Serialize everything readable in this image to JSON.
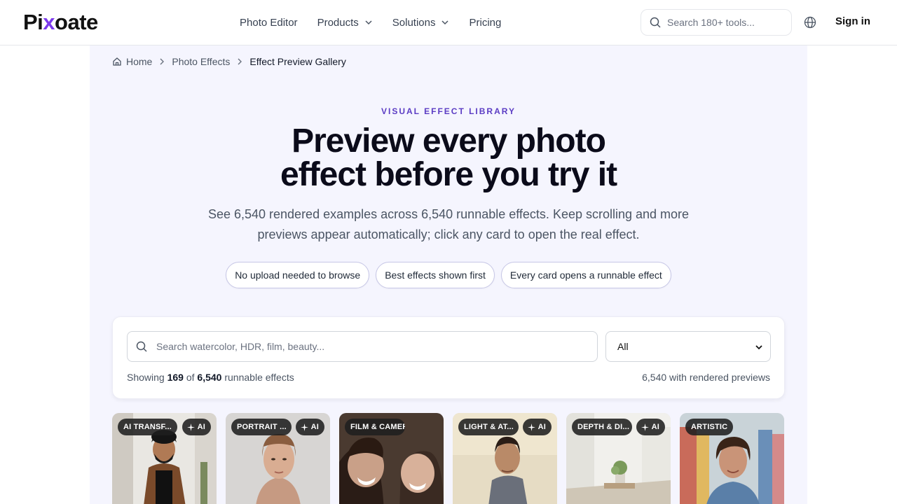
{
  "header": {
    "logo": {
      "pre": "Pi",
      "x": "x",
      "post": "oate"
    },
    "nav": [
      {
        "label": "Photo Editor",
        "dropdown": false
      },
      {
        "label": "Products",
        "dropdown": true
      },
      {
        "label": "Solutions",
        "dropdown": true
      },
      {
        "label": "Pricing",
        "dropdown": false
      }
    ],
    "search_placeholder": "Search 180+ tools...",
    "signin": "Sign in"
  },
  "breadcrumb": [
    "Home",
    "Photo Effects",
    "Effect Preview Gallery"
  ],
  "hero": {
    "eyebrow": "VISUAL EFFECT LIBRARY",
    "title_line1": "Preview every photo",
    "title_line2": "effect before you try it",
    "subtitle": "See 6,540 rendered examples across 6,540 runnable effects. Keep scrolling and more previews appear automatically; click any card to open the real effect.",
    "pills": [
      "No upload needed to browse",
      "Best effects shown first",
      "Every card opens a runnable effect"
    ]
  },
  "filter": {
    "search_placeholder": "Search watercolor, HDR, film, beauty...",
    "select_value": "All",
    "showing_pre": "Showing",
    "showing_count": "169",
    "showing_of": "of",
    "showing_total": "6,540",
    "showing_post": "runnable effects",
    "previews_text": "6,540 with rendered previews"
  },
  "cards": [
    {
      "category": "AI TRANSF...",
      "ai": true,
      "ai_label": "AI"
    },
    {
      "category": "PORTRAIT ...",
      "ai": true,
      "ai_label": "AI"
    },
    {
      "category": "FILM & CAMERA",
      "ai": false,
      "ai_label": ""
    },
    {
      "category": "LIGHT & AT...",
      "ai": true,
      "ai_label": "AI"
    },
    {
      "category": "DEPTH & DI...",
      "ai": true,
      "ai_label": "AI"
    },
    {
      "category": "ARTISTIC",
      "ai": false,
      "ai_label": ""
    }
  ],
  "colors": {
    "accent": "#5b3cc4",
    "logo_x": "#7c3aed",
    "page_bg": "#f5f5fe"
  }
}
